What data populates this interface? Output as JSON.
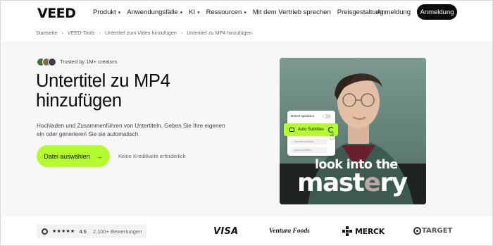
{
  "header": {
    "logo": "VEED",
    "nav": [
      {
        "label": "Produkt",
        "has_menu": true
      },
      {
        "label": "Anwendungsfälle",
        "has_menu": true
      },
      {
        "label": "KI",
        "has_menu": true
      },
      {
        "label": "Ressourcen",
        "has_menu": true
      },
      {
        "label": "Mit dem Vertrieb sprechen",
        "has_menu": false
      },
      {
        "label": "Preisgestaltung",
        "has_menu": false
      }
    ],
    "login_label": "Anmeldung",
    "signup_label": "Anmeldung"
  },
  "breadcrumb": [
    "Startseite",
    "VEED-Tools",
    "Untertitel zum Video hinzufügen",
    "Untertitel zu MP4 hinzufügen"
  ],
  "hero": {
    "trusted_text": "Trusted by 1M+ creators",
    "title": "Untertitel zu MP4 hinzufügen",
    "description": "Hochladen und Zusammenführen von Untertiteln. Geben Sie Ihre eigenen ein oder generieren Sie sie automatisch",
    "cta_label": "Datei auswählen",
    "no_card_text": "Keine Kreditkarte erforderlich"
  },
  "media": {
    "detect_speakers_label": "Detect speakers",
    "auto_subtitles_label": "Auto Subtitles",
    "ghost_option_1": "Translate subtitles",
    "ghost_option_2": "Upload subtitles",
    "caption_line1": "look into the",
    "caption_line2_bright": "mast",
    "caption_line2_dim": "e",
    "caption_line2_rest": "ry"
  },
  "rating": {
    "stars": "★★★★★",
    "score": "4.6",
    "reviews": "2,100+ Bewertungen"
  },
  "logos": {
    "visa": "VISA",
    "ventura": "Ventura Foods",
    "merck": "MERCK",
    "target": "TARGET"
  },
  "colors": {
    "accent": "#b4fb2f",
    "dark": "#0b0b0b"
  }
}
